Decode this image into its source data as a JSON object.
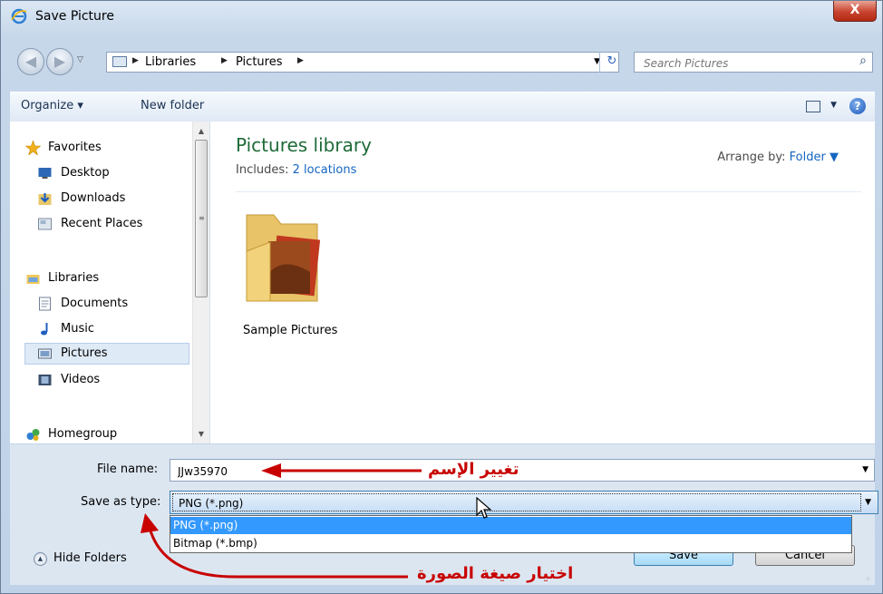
{
  "window": {
    "title": "Save Picture",
    "close_label": "X"
  },
  "address": {
    "breadcrumbs": [
      "Libraries",
      "Pictures"
    ],
    "search_placeholder": "Search Pictures"
  },
  "toolbar": {
    "organize_label": "Organize ▾",
    "new_folder_label": "New folder"
  },
  "sidebar": {
    "items": [
      {
        "label": "Favorites",
        "icon": "star-icon"
      },
      {
        "label": "Desktop",
        "icon": "desktop-icon"
      },
      {
        "label": "Downloads",
        "icon": "downloads-icon"
      },
      {
        "label": "Recent Places",
        "icon": "recent-places-icon"
      },
      {
        "label": "Libraries",
        "icon": "libraries-icon"
      },
      {
        "label": "Documents",
        "icon": "documents-icon"
      },
      {
        "label": "Music",
        "icon": "music-icon"
      },
      {
        "label": "Pictures",
        "icon": "pictures-icon",
        "selected": true
      },
      {
        "label": "Videos",
        "icon": "videos-icon"
      },
      {
        "label": "Homegroup",
        "icon": "homegroup-icon"
      }
    ]
  },
  "content": {
    "title": "Pictures library",
    "includes_label": "Includes:",
    "includes_link": "2 locations",
    "arrange_label": "Arrange by:",
    "arrange_value": "Folder",
    "folders": [
      {
        "label": "Sample Pictures"
      }
    ]
  },
  "bottom": {
    "file_name_label": "File name:",
    "file_name_value": "JJw35970",
    "save_type_label": "Save as type:",
    "save_type_value": "PNG (*.png)",
    "type_options": [
      "PNG (*.png)",
      "Bitmap (*.bmp)"
    ],
    "hide_folders_label": "Hide Folders",
    "save_label": "Save",
    "cancel_label": "Cancel"
  },
  "annotations": {
    "rename": "تغيير الإسم",
    "choose_format": "اختيار صيغة الصورة"
  },
  "colors": {
    "annotation": "#c80000",
    "library_title": "#1e6b38",
    "link": "#1565c0",
    "selection": "#3399ff"
  }
}
